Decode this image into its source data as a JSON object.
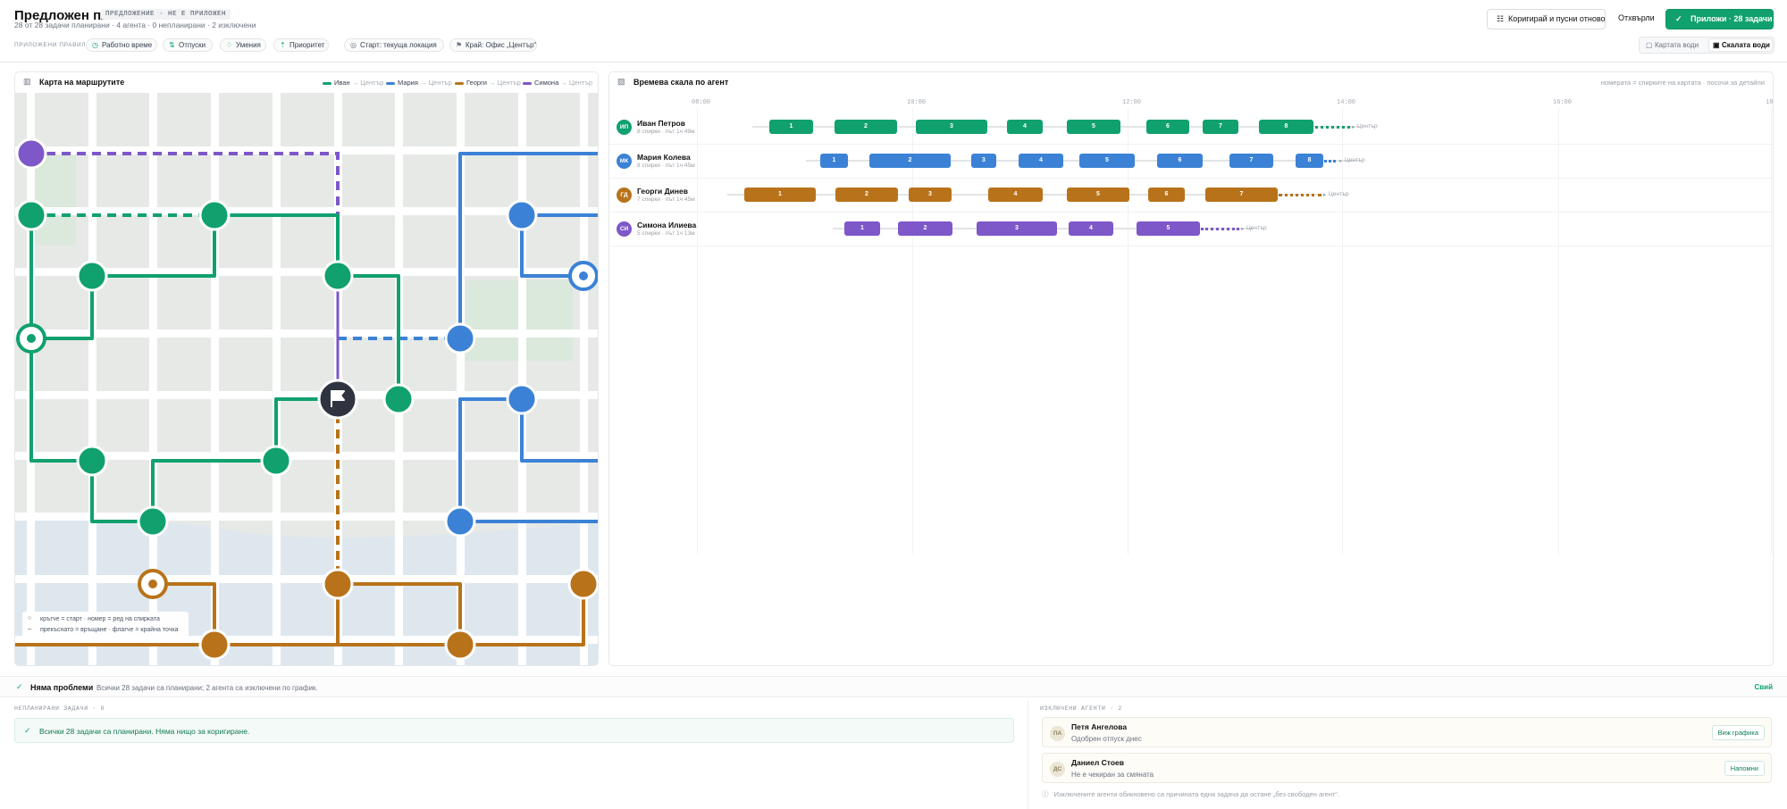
{
  "header": {
    "title": "Предложен план",
    "badge": "ПРЕДЛОЖЕНИЕ · НЕ Е ПРИЛОЖЕН",
    "subtitle": "28 от 28 задачи планирани · 4 агента · 0 непланирани · 2 изключени",
    "rules_label": "ПРИЛОЖЕНИ ПРАВИЛА",
    "chips": [
      "Работно време",
      "Отпуски",
      "Умения",
      "Приоритет",
      "Старт: текуща локация",
      "Край: Офис „Център“"
    ],
    "buttons": {
      "adjust": "Коригирай и пусни отново",
      "reject": "Отхвърли",
      "apply": "Приложи · 28 задачи"
    },
    "view_toggle": {
      "map": "Картата води",
      "timeline": "Скалата води"
    }
  },
  "map_panel": {
    "title": "Карта на маршрутите",
    "legend": [
      {
        "name": "Иван",
        "suffix": "→ Център",
        "color": "#10a16e"
      },
      {
        "name": "Мария",
        "suffix": "→ Център",
        "color": "#3b82d6"
      },
      {
        "name": "Георги",
        "suffix": "→ Център",
        "color": "#b8731a"
      },
      {
        "name": "Симона",
        "suffix": "→ Център",
        "color": "#7e57c9"
      }
    ],
    "map_legend": {
      "line1": "кръгче = старт · номер = ред на спирката",
      "line2": "прекъснато = връщане · флагче = крайна точка"
    }
  },
  "timeline_panel": {
    "title": "Времева скала по агент",
    "hint": "номерата = спирките на картата · посочи за детайли",
    "ticks": [
      "08:00",
      "10:00",
      "12:00",
      "14:00",
      "16:00",
      "18"
    ],
    "agents": [
      {
        "initials": "ИП",
        "name": "Иван Петров",
        "meta": "8 спирки · път 1ч 49м",
        "color": "#10a16e",
        "stops": [
          "1",
          "2",
          "3",
          "4",
          "5",
          "6",
          "7",
          "8"
        ],
        "end": "Център"
      },
      {
        "initials": "МК",
        "name": "Мария Колева",
        "meta": "8 спирки · път 1ч 45м",
        "color": "#3b82d6",
        "stops": [
          "1",
          "2",
          "3",
          "4",
          "5",
          "6",
          "7",
          "8"
        ],
        "end": "Център"
      },
      {
        "initials": "ГД",
        "name": "Георги Динев",
        "meta": "7 спирки · път 1ч 45м",
        "color": "#b8731a",
        "stops": [
          "1",
          "2",
          "3",
          "4",
          "5",
          "6",
          "7"
        ],
        "end": "Център"
      },
      {
        "initials": "СИ",
        "name": "Симона Илиева",
        "meta": "5 спирки · път 1ч 13м",
        "color": "#7e57c9",
        "stops": [
          "1",
          "2",
          "3",
          "4",
          "5"
        ],
        "end": "Център"
      }
    ]
  },
  "status_bar": {
    "title": "Няма проблеми",
    "text": "Всички 28 задачи са планирани; 2 агента са изключени по график.",
    "collapse": "Свий"
  },
  "unplanned": {
    "label": "НЕПЛАНИРАНИ ЗАДАЧИ · 0",
    "message": "Всички 28 задачи са планирани. Няма нищо за коригиране."
  },
  "excluded": {
    "label": "ИЗКЛЮЧЕНИ АГЕНТИ · 2",
    "agents": [
      {
        "initials": "ПА",
        "name": "Петя Ангелова",
        "reason": "Одобрен отпуск днес",
        "action": "Виж графика"
      },
      {
        "initials": "ДС",
        "name": "Даниел Стоев",
        "reason": "Не е чекиран за смяната",
        "action": "Напомни"
      }
    ],
    "note": "Изключените агенти обикновено са причината една задача да остане „без свободен агент“."
  }
}
